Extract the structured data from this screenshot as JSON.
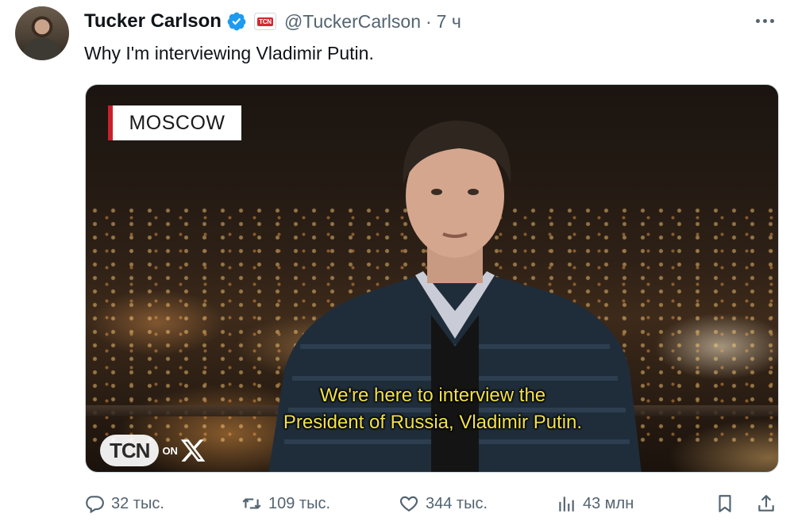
{
  "tweet": {
    "author_name": "Tucker Carlson",
    "affiliation_badge": "TCN",
    "handle": "@TuckerCarlson",
    "separator": "·",
    "time": "7 ч",
    "text": "Why I'm interviewing Vladimir Putin."
  },
  "media": {
    "location_tag": "MOSCOW",
    "subtitle_line1": "We're here to interview the",
    "subtitle_line2": "President of Russia, Vladimir Putin.",
    "logo_text": "TCN",
    "logo_on": "ON",
    "subtitle_color": "#f2e14a",
    "location_accent": "#c8202a"
  },
  "actions": {
    "replies": "32 тыс.",
    "reposts": "109 тыс.",
    "likes": "344 тыс.",
    "views": "43 млн"
  },
  "icons": {
    "verified": "verified-badge-icon",
    "more": "more-dots-icon",
    "reply": "reply-bubble-icon",
    "repost": "repost-arrows-icon",
    "like": "heart-icon",
    "views": "bar-chart-icon",
    "bookmark": "bookmark-icon",
    "share": "share-upload-icon"
  },
  "colors": {
    "verified_blue": "#1d9bf0",
    "muted_text": "#536471",
    "text": "#0f1419"
  }
}
